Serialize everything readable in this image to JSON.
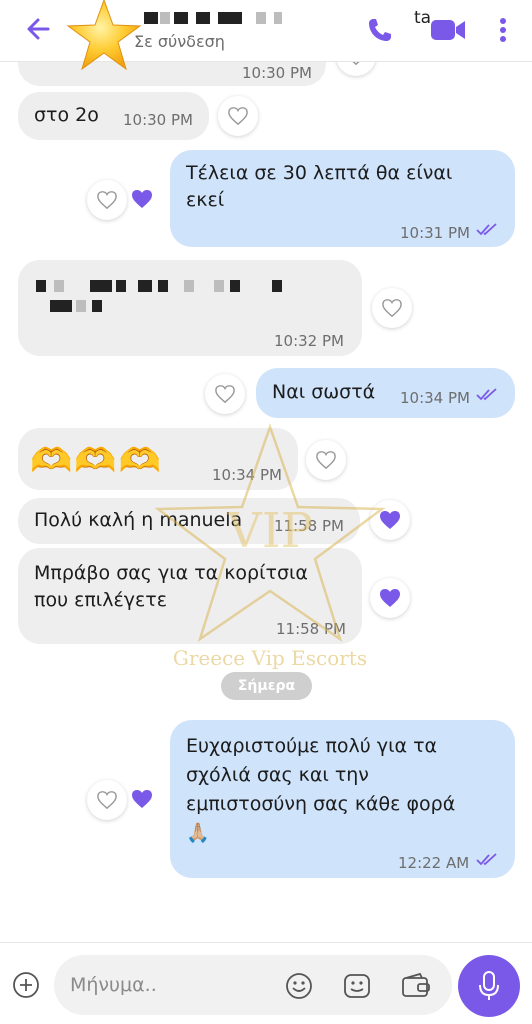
{
  "header": {
    "contact_name_suffix": "ta",
    "status": "Σε σύνδεση"
  },
  "messages": [
    {
      "id": "m0",
      "direction": "incoming",
      "time": "10:30 PM",
      "partial": true
    },
    {
      "id": "m1",
      "direction": "incoming",
      "text": "στο 2ο",
      "time": "10:30 PM",
      "liked": false
    },
    {
      "id": "m2",
      "direction": "outgoing",
      "lines": [
        "Τέλεια σε 30 λεπτά θα είναι",
        "εκεί"
      ],
      "time": "10:31 PM",
      "liked": true
    },
    {
      "id": "m3",
      "direction": "incoming",
      "redacted": true,
      "time": "10:32 PM",
      "liked": false
    },
    {
      "id": "m4",
      "direction": "outgoing",
      "text": "Ναι σωστά",
      "time": "10:34 PM",
      "liked": false
    },
    {
      "id": "m5",
      "direction": "incoming",
      "emoji": "🫶🫶🫶",
      "time": "10:34 PM",
      "liked": false
    },
    {
      "id": "m6",
      "direction": "incoming",
      "text": "Πολύ καλή η manuela",
      "time": "11:58 PM",
      "liked": true
    },
    {
      "id": "m7",
      "direction": "incoming",
      "lines": [
        "Μπράβο σας για τα κορίτσια",
        "που επιλέγετε"
      ],
      "time": "11:58 PM",
      "liked": true
    },
    {
      "id": "m8",
      "direction": "outgoing",
      "lines": [
        "Ευχαριστούμε πολύ για τα",
        "σχόλιά σας και την",
        "εμπιστοσύνη σας κάθε φορά",
        "🙏🏼"
      ],
      "time": "12:22 AM",
      "liked": true
    }
  ],
  "date_separator": "Σήμερα",
  "watermark": {
    "badge": "VIP",
    "caption": "Greece Vip Escorts"
  },
  "composer": {
    "placeholder": "Μήνυμα.."
  },
  "icons": {
    "back": "arrow-left-icon",
    "call": "phone-icon",
    "video": "video-camera-icon",
    "more": "more-vertical-icon",
    "heart": "heart-icon",
    "ticks": "double-check-icon",
    "plus": "plus-circle-icon",
    "emoji": "smiley-icon",
    "sticker": "sticker-icon",
    "wallet": "wallet-icon",
    "mic": "microphone-icon"
  },
  "colors": {
    "accent": "#7b59e8",
    "incoming_bubble": "#eeeeee",
    "outgoing_bubble": "#cfe3fb",
    "liked_heart": "#7b59e8",
    "date_pill": "#cfcfcf"
  }
}
